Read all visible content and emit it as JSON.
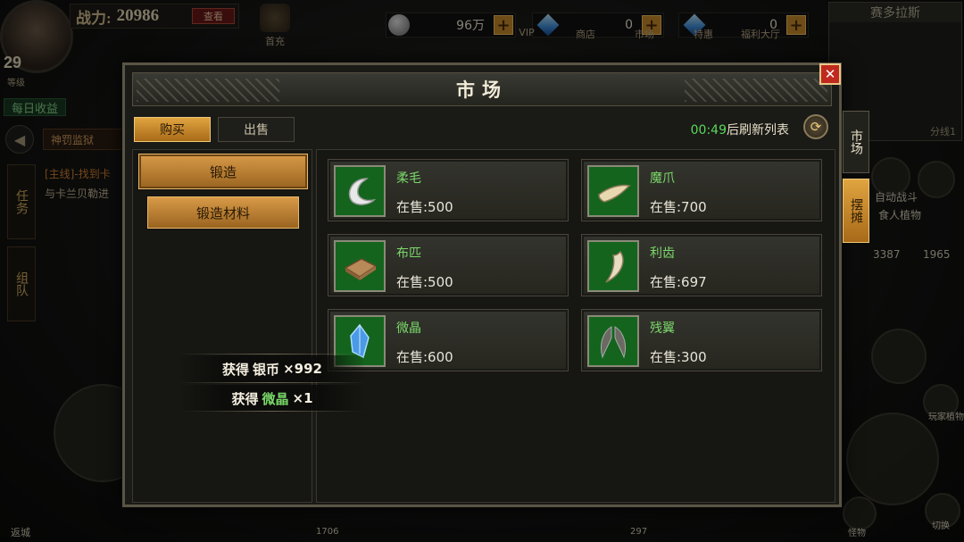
{
  "hud": {
    "level": "29",
    "level_sub": "等级",
    "power_label": "战力:",
    "power_value": "20986",
    "power_btn": "查看",
    "daily_income": "每日收益",
    "quest_tag": "神罚监狱",
    "quest_main": "[主线]-找到卡",
    "quest_sub": "与卡兰贝勒进",
    "side_tab_task": "任务",
    "side_tab_team": "组队",
    "coins": "96万",
    "gems": "0",
    "diamonds": "0",
    "first_charge": "首充",
    "icons": [
      {
        "label": "VIP",
        "icon": "vip-icon"
      },
      {
        "label": "商店",
        "icon": "shop-icon"
      },
      {
        "label": "市场",
        "icon": "market-icon"
      },
      {
        "label": "特惠",
        "icon": "deal-icon"
      },
      {
        "label": "福利大厅",
        "icon": "welfare-icon"
      }
    ],
    "map_name": "赛多拉斯",
    "map_left": "81",
    "map_line": "分线1",
    "auto_battle": "自动战斗",
    "plant": "食人植物",
    "num_a": "3387",
    "num_b": "1965",
    "player_plant": "玩家植物",
    "switch_lbl": "切换",
    "pet_lbl": "怪物",
    "return_lbl": "返城",
    "bottom_num_1": "1706",
    "bottom_num_2": "297"
  },
  "modal": {
    "title": "市场",
    "close": "✕",
    "tabs": [
      "购买",
      "出售"
    ],
    "refresh_time": "00:49",
    "refresh_suffix": "后刷新列表",
    "categories": [
      "锻造",
      "锻造材料"
    ],
    "side_market": "市场",
    "side_stall": "摆摊",
    "items": [
      {
        "name": "柔毛",
        "stock": "在售:500",
        "icon": "fur-icon"
      },
      {
        "name": "魔爪",
        "stock": "在售:700",
        "icon": "claw-icon"
      },
      {
        "name": "布匹",
        "stock": "在售:500",
        "icon": "cloth-icon"
      },
      {
        "name": "利齿",
        "stock": "在售:697",
        "icon": "fang-icon"
      },
      {
        "name": "微晶",
        "stock": "在售:600",
        "icon": "crystal-icon"
      },
      {
        "name": "残翼",
        "stock": "在售:300",
        "icon": "wing-icon"
      }
    ]
  },
  "toasts": [
    {
      "prefix": "获得",
      "item": "银币",
      "count": "×992"
    },
    {
      "prefix": "获得",
      "item": "微晶",
      "count": "×1"
    }
  ],
  "colors": {
    "item_name": "#7ad86a",
    "timer": "#5ad85a",
    "accent_gold": "#d89a48",
    "icon_bg": "#14641e",
    "close_red": "#c02a1e"
  }
}
